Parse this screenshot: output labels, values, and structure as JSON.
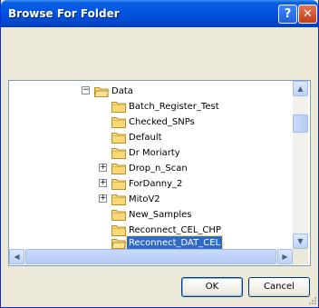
{
  "window": {
    "title": "Browse For Folder",
    "help_glyph": "?",
    "close_glyph": "✕"
  },
  "tree": {
    "root": {
      "label": "Data",
      "expanded": true
    },
    "items": [
      {
        "label": "Batch_Register_Test",
        "expander": ""
      },
      {
        "label": "Checked_SNPs",
        "expander": ""
      },
      {
        "label": "Default",
        "expander": ""
      },
      {
        "label": "Dr Moriarty",
        "expander": ""
      },
      {
        "label": "Drop_n_Scan",
        "expander": "+"
      },
      {
        "label": "ForDanny_2",
        "expander": "+"
      },
      {
        "label": "MitoV2",
        "expander": "+"
      },
      {
        "label": "New_Samples",
        "expander": ""
      },
      {
        "label": "Reconnect_CEL_CHP",
        "expander": ""
      },
      {
        "label": "Reconnect_DAT_CEL",
        "expander": "",
        "selected": true
      }
    ]
  },
  "buttons": {
    "ok": "OK",
    "cancel": "Cancel"
  },
  "colors": {
    "selection": "#316ac5",
    "folder": "#f8d775",
    "titlebar": "#0054e3"
  }
}
